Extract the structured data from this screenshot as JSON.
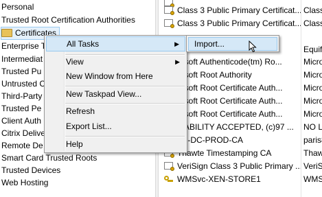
{
  "tree": {
    "items": [
      {
        "label": "Personal",
        "selected": false
      },
      {
        "label": "Trusted Root Certification Authorities",
        "selected": false
      },
      {
        "label": "Certificates",
        "selected": true
      },
      {
        "label": "Enterprise T",
        "selected": false
      },
      {
        "label": "Intermediat",
        "selected": false
      },
      {
        "label": "Trusted Pu",
        "selected": false
      },
      {
        "label": "Untrusted C",
        "selected": false
      },
      {
        "label": "Third-Party",
        "selected": false
      },
      {
        "label": "Trusted Pe",
        "selected": false
      },
      {
        "label": "Client Auth",
        "selected": false
      },
      {
        "label": "Citrix Delive",
        "selected": false
      },
      {
        "label": "Remote De",
        "selected": false
      },
      {
        "label": "Smart Card Trusted Roots",
        "selected": false
      },
      {
        "label": "Trusted Devices",
        "selected": false
      },
      {
        "label": "Web Hosting",
        "selected": false
      }
    ]
  },
  "list": {
    "rows": [
      {
        "issued_to": "",
        "issued_by": "",
        "icon": "certificate-icon"
      },
      {
        "issued_to": "Class 3 Public Primary Certificat...",
        "issued_by": "Class",
        "icon": "certificate-icon"
      },
      {
        "issued_to": "Class 3 Public Primary Certificat...",
        "issued_by": "Class",
        "icon": "certificate-icon"
      },
      {
        "issued_to": "",
        "issued_by": "Equif",
        "icon": "certificate-icon"
      },
      {
        "issued_to": "rosoft Authenticode(tm) Ro...",
        "issued_by": "Micro",
        "icon": "certificate-icon"
      },
      {
        "issued_to": "rosoft Root Authority",
        "issued_by": "Micro",
        "icon": "certificate-icon"
      },
      {
        "issued_to": "rosoft Root Certificate Auth...",
        "issued_by": "Micro",
        "icon": "certificate-icon"
      },
      {
        "issued_to": "rosoft Root Certificate Auth...",
        "issued_by": "Micro",
        "icon": "certificate-icon"
      },
      {
        "issued_to": "rosoft Root Certificate Auth...",
        "issued_by": "Micro",
        "icon": "certificate-icon"
      },
      {
        "issued_to": "LIABILITY ACCEPTED, (c)97 ...",
        "issued_by": "NO L",
        "icon": "certificate-icon"
      },
      {
        "issued_to": "is8-DC-PROD-CA",
        "issued_by": "paris8",
        "icon": "certificate-icon"
      },
      {
        "issued_to": "Thawte Timestamping CA",
        "issued_by": "Thaw",
        "icon": "certificate-icon"
      },
      {
        "issued_to": "VeriSign Class 3 Public Primary ...",
        "issued_by": "VeriS",
        "icon": "certificate-icon"
      },
      {
        "issued_to": "WMSvc-XEN-STORE1",
        "issued_by": "WMS",
        "icon": "certificate-key-icon"
      }
    ]
  },
  "context_menu": {
    "all_tasks": "All Tasks",
    "view": "View",
    "new_window": "New Window from Here",
    "new_taskpad": "New Taskpad View...",
    "refresh": "Refresh",
    "export_list": "Export List...",
    "help": "Help"
  },
  "submenu": {
    "import": "Import..."
  },
  "colors": {
    "menu_bg": "#f0f0f0",
    "highlight": "#d5e8f7",
    "highlight_border": "#99c9ef",
    "selected_tree_bg": "#e5f1fb"
  }
}
